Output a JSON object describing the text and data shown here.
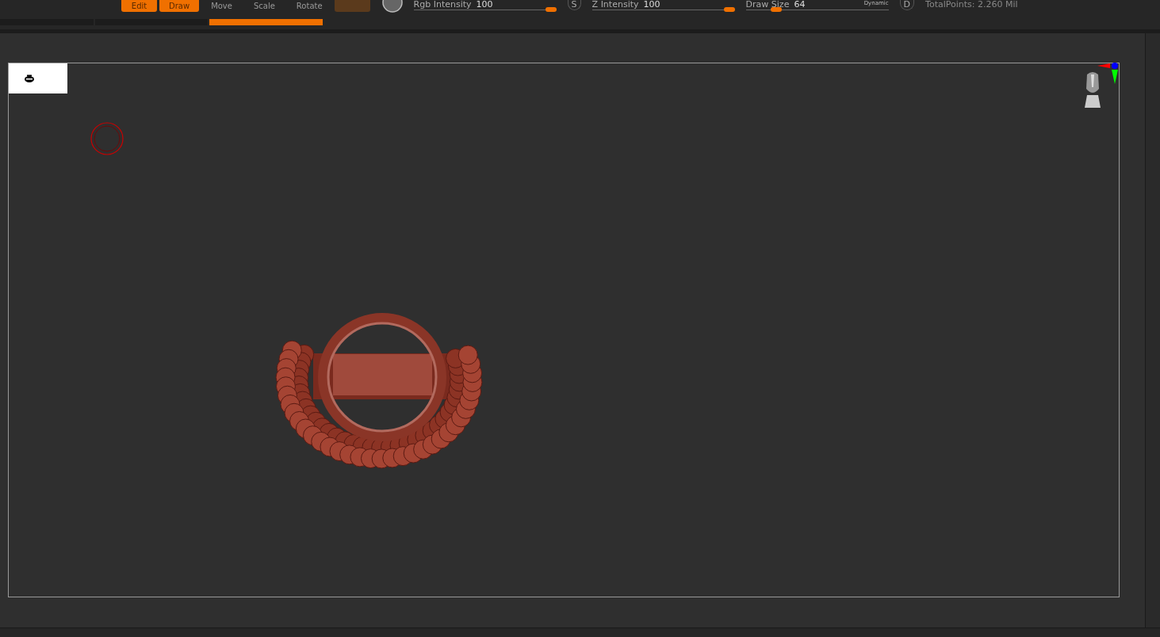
{
  "toolbar": {
    "buttons": [
      {
        "label": "Edit",
        "selected": true
      },
      {
        "label": "Draw",
        "selected": true
      },
      {
        "label": "Move",
        "selected": false
      },
      {
        "label": "Scale",
        "selected": false
      },
      {
        "label": "Rotate",
        "selected": false
      }
    ],
    "sliders": [
      {
        "label": "Rgb Intensity",
        "value": "100",
        "level": 1.0,
        "toggle": "S"
      },
      {
        "label": "Z Intensity",
        "value": "100",
        "level": 1.0
      },
      {
        "label": "Draw Size",
        "value": "64",
        "level": 0.25,
        "badge": "Dynamic",
        "toggle": "D"
      }
    ],
    "total_points": "TotalPoints: 2.260 Mil"
  },
  "tabs": [
    {
      "selected": false
    },
    {
      "selected": false
    },
    {
      "selected": true
    }
  ]
}
